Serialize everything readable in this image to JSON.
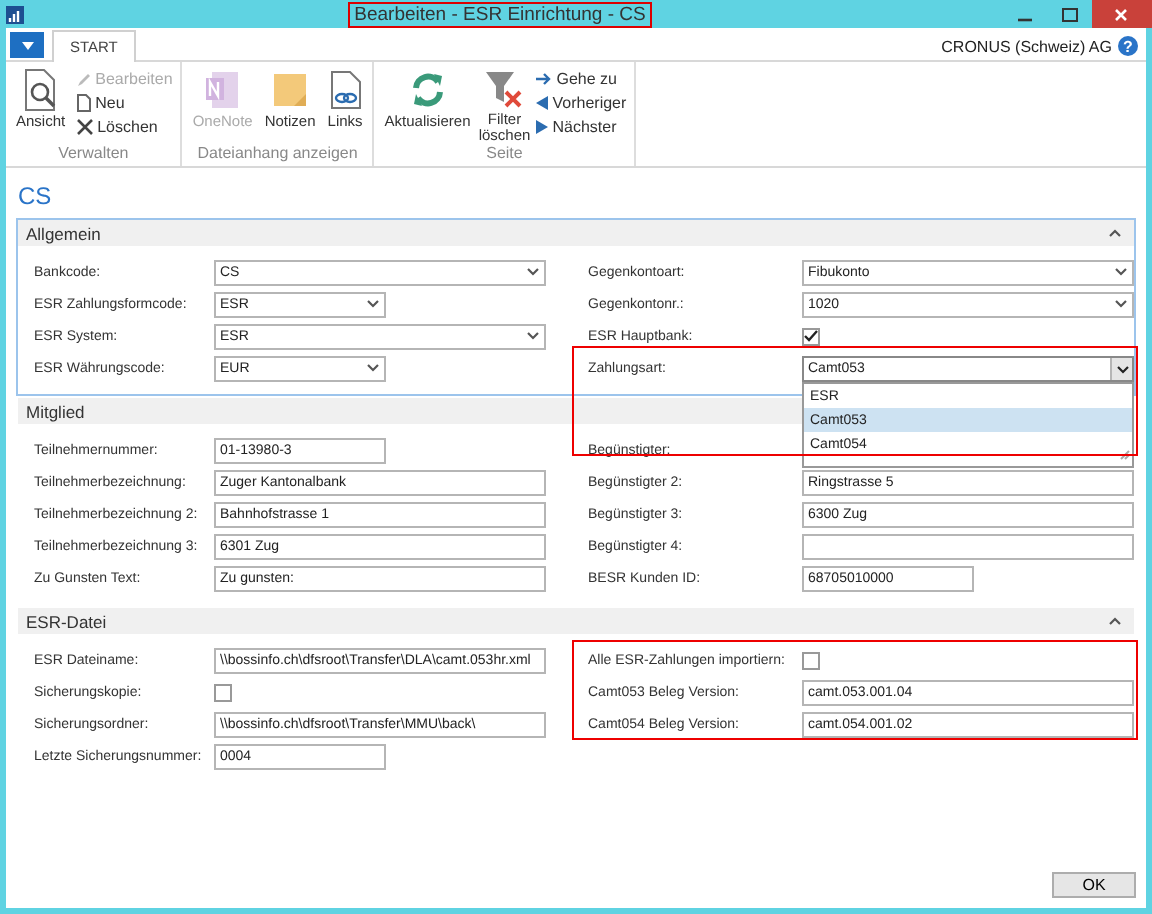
{
  "window": {
    "title": "Bearbeiten - ESR Einrichtung - CS"
  },
  "ribbon": {
    "tabs": [
      {
        "label": "START",
        "selected": true
      }
    ],
    "company": "CRONUS (Schweiz) AG",
    "help": "?",
    "groups": [
      {
        "label": "Verwalten",
        "items": [
          {
            "kind": "large",
            "label": "Ansicht",
            "disabled": false
          },
          {
            "kind": "small",
            "label": "Bearbeiten",
            "disabled": true
          },
          {
            "kind": "small",
            "label": "Neu",
            "disabled": false
          },
          {
            "kind": "small",
            "label": "Löschen",
            "disabled": false
          }
        ]
      },
      {
        "label": "Dateianhang anzeigen",
        "items": [
          {
            "kind": "large",
            "label": "OneNote",
            "disabled": true
          },
          {
            "kind": "large",
            "label": "Notizen",
            "disabled": false
          },
          {
            "kind": "large",
            "label": "Links",
            "disabled": false
          }
        ]
      },
      {
        "label": "Seite",
        "items": [
          {
            "kind": "large",
            "label": "Aktualisieren",
            "disabled": false
          },
          {
            "kind": "large",
            "label": "Filter löschen",
            "disabled": false
          },
          {
            "kind": "small",
            "label": "Gehe zu",
            "disabled": false
          },
          {
            "kind": "small",
            "label": "Vorheriger",
            "disabled": false
          },
          {
            "kind": "small",
            "label": "Nächster",
            "disabled": false
          }
        ]
      }
    ]
  },
  "page_title": "CS",
  "sections": [
    {
      "title": "Allgemein",
      "focused": true,
      "expanded": true,
      "left": [
        {
          "label": "Bankcode:",
          "kind": "dropdown",
          "value": "CS"
        },
        {
          "label": "ESR Zahlungsformcode:",
          "kind": "dropdown",
          "value": "ESR",
          "short": true
        },
        {
          "label": "ESR System:",
          "kind": "dropdown",
          "value": "ESR"
        },
        {
          "label": "ESR Währungscode:",
          "kind": "dropdown",
          "value": "EUR",
          "short": true
        }
      ],
      "right": [
        {
          "label": "Gegenkontoart:",
          "kind": "dropdown",
          "value": "Fibukonto"
        },
        {
          "label": "Gegenkontonr.:",
          "kind": "dropdown",
          "value": "1020"
        },
        {
          "label": "ESR Hauptbank:",
          "kind": "checkbox",
          "checked": true
        },
        {
          "label": "Zahlungsart:",
          "kind": "dropdown",
          "value": "Camt053",
          "open": true,
          "options": [
            {
              "label": "ESR",
              "selected": false
            },
            {
              "label": "Camt053",
              "selected": true
            },
            {
              "label": "Camt054",
              "selected": false
            }
          ]
        }
      ]
    },
    {
      "title": "Mitglied",
      "expanded": true,
      "left": [
        {
          "label": "Teilnehmernummer:",
          "kind": "text",
          "value": "01-13980-3",
          "short": true
        },
        {
          "label": "Teilnehmerbezeichnung:",
          "kind": "text",
          "value": "Zuger Kantonalbank"
        },
        {
          "label": "Teilnehmerbezeichnung 2:",
          "kind": "text",
          "value": "Bahnhofstrasse 1"
        },
        {
          "label": "Teilnehmerbezeichnung 3:",
          "kind": "text",
          "value": "6301 Zug"
        },
        {
          "label": "Zu Gunsten Text:",
          "kind": "text",
          "value": "Zu gunsten:"
        }
      ],
      "right": [
        {
          "label": "Begünstigter:",
          "kind": "text"
        },
        {
          "label": "Begünstigter 2:",
          "kind": "text",
          "value": "Ringstrasse 5"
        },
        {
          "label": "Begünstigter 3:",
          "kind": "text",
          "value": "6300 Zug"
        },
        {
          "label": "Begünstigter 4:",
          "kind": "text"
        },
        {
          "label": "BESR Kunden ID:",
          "kind": "text",
          "value": "68705010000",
          "short": true
        }
      ]
    },
    {
      "title": "ESR-Datei",
      "expanded": true,
      "left": [
        {
          "label": "ESR Dateiname:",
          "kind": "text",
          "value": "\\\\bossinfo.ch\\dfsroot\\Transfer\\DLA\\camt.053hr.xml"
        },
        {
          "label": "Sicherungskopie:",
          "kind": "checkbox",
          "checked": false
        },
        {
          "label": "Sicherungsordner:",
          "kind": "text",
          "value": "\\\\bossinfo.ch\\dfsroot\\Transfer\\MMU\\back\\"
        },
        {
          "label": "Letzte Sicherungsnummer:",
          "kind": "text",
          "value": "0004",
          "short": true
        }
      ],
      "right": [
        {
          "label": "Alle ESR-Zahlungen importiern:",
          "kind": "checkbox",
          "checked": false
        },
        {
          "label": "Camt053 Beleg Version:",
          "kind": "text",
          "value": "camt.053.001.04"
        },
        {
          "label": "Camt054 Beleg Version:",
          "kind": "text",
          "value": "camt.054.001.02"
        }
      ]
    }
  ],
  "buttons": [
    {
      "label": "OK"
    }
  ]
}
